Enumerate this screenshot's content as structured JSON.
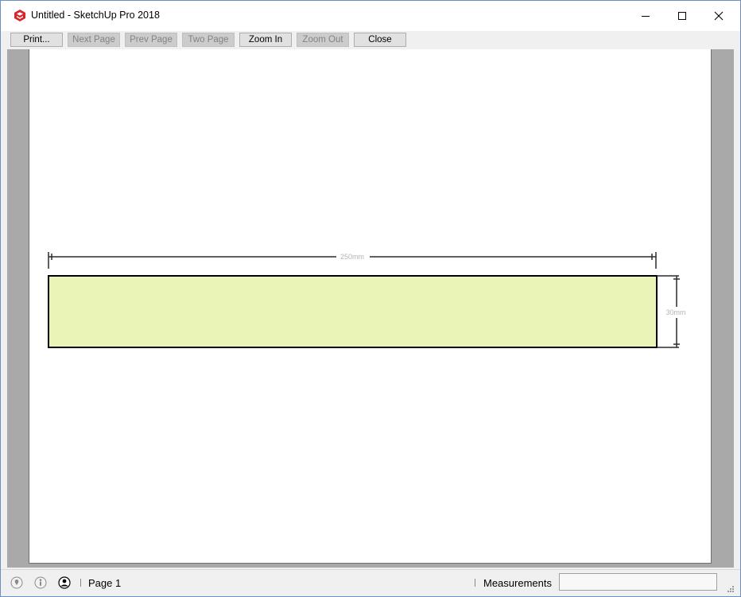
{
  "window": {
    "title": "Untitled - SketchUp Pro 2018",
    "app_icon": "sketchup-logo-icon",
    "controls": [
      "minimize-icon",
      "maximize-icon",
      "close-icon"
    ]
  },
  "toolbar": {
    "buttons": [
      {
        "label": "Print...",
        "enabled": true
      },
      {
        "label": "Next Page",
        "enabled": false
      },
      {
        "label": "Prev Page",
        "enabled": false
      },
      {
        "label": "Two Page",
        "enabled": false
      },
      {
        "label": "Zoom In",
        "enabled": true
      },
      {
        "label": "Zoom Out",
        "enabled": false
      },
      {
        "label": "Close",
        "enabled": true
      }
    ]
  },
  "drawing": {
    "width_dimension": "250mm",
    "height_dimension": "30mm",
    "fill_color": "#eaf4b6"
  },
  "status": {
    "icons": [
      "geo-location-icon",
      "credits-icon",
      "user-account-icon"
    ],
    "page": "Page 1",
    "measurements_label": "Measurements",
    "measurements_value": ""
  }
}
